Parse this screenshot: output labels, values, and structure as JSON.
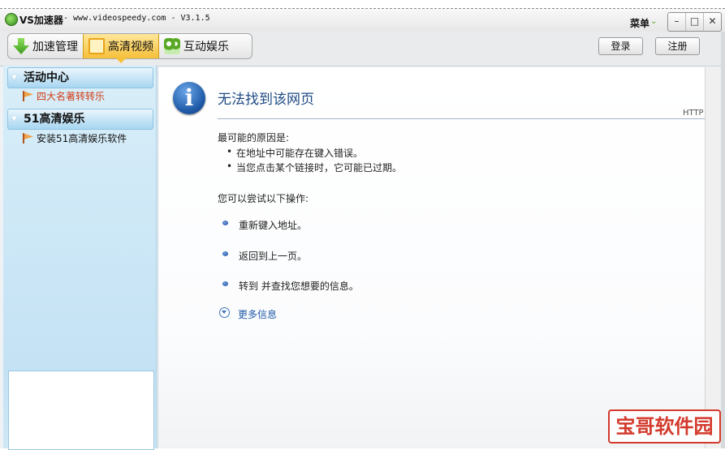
{
  "window": {
    "app_name": "VS加速器",
    "subtitle": " - www.videospeedy.com - V3.1.5",
    "menu_label": "菜单",
    "minimize_glyph": "–",
    "maximize_glyph": "□",
    "close_glyph": "✕"
  },
  "toolbar": {
    "tabs": [
      {
        "label": "加速管理",
        "icon": "download-arrow-icon"
      },
      {
        "label": "高清视频",
        "icon": "film-icon",
        "active": true
      },
      {
        "label": "互动娱乐",
        "icon": "camera-icon"
      }
    ],
    "login_label": "登录",
    "register_label": "注册"
  },
  "sidebar": {
    "sections": [
      {
        "title": "活动中心",
        "items": [
          "四大名著转转乐"
        ]
      },
      {
        "title": "51高清娱乐",
        "items": [
          "安装51高清娱乐软件"
        ]
      }
    ]
  },
  "content": {
    "title": "无法找到该网页",
    "http_label": "HTTP",
    "reasons_heading": "最可能的原因是:",
    "reasons": [
      "在地址中可能存在键入错误。",
      "当您点击某个链接时，它可能已过期。"
    ],
    "actions_heading": "您可以尝试以下操作:",
    "actions": [
      "重新键入地址。",
      "返回到上一页。",
      "转到  并查找您想要的信息。"
    ],
    "more_info": "更多信息"
  },
  "watermark": "宝哥软件园"
}
